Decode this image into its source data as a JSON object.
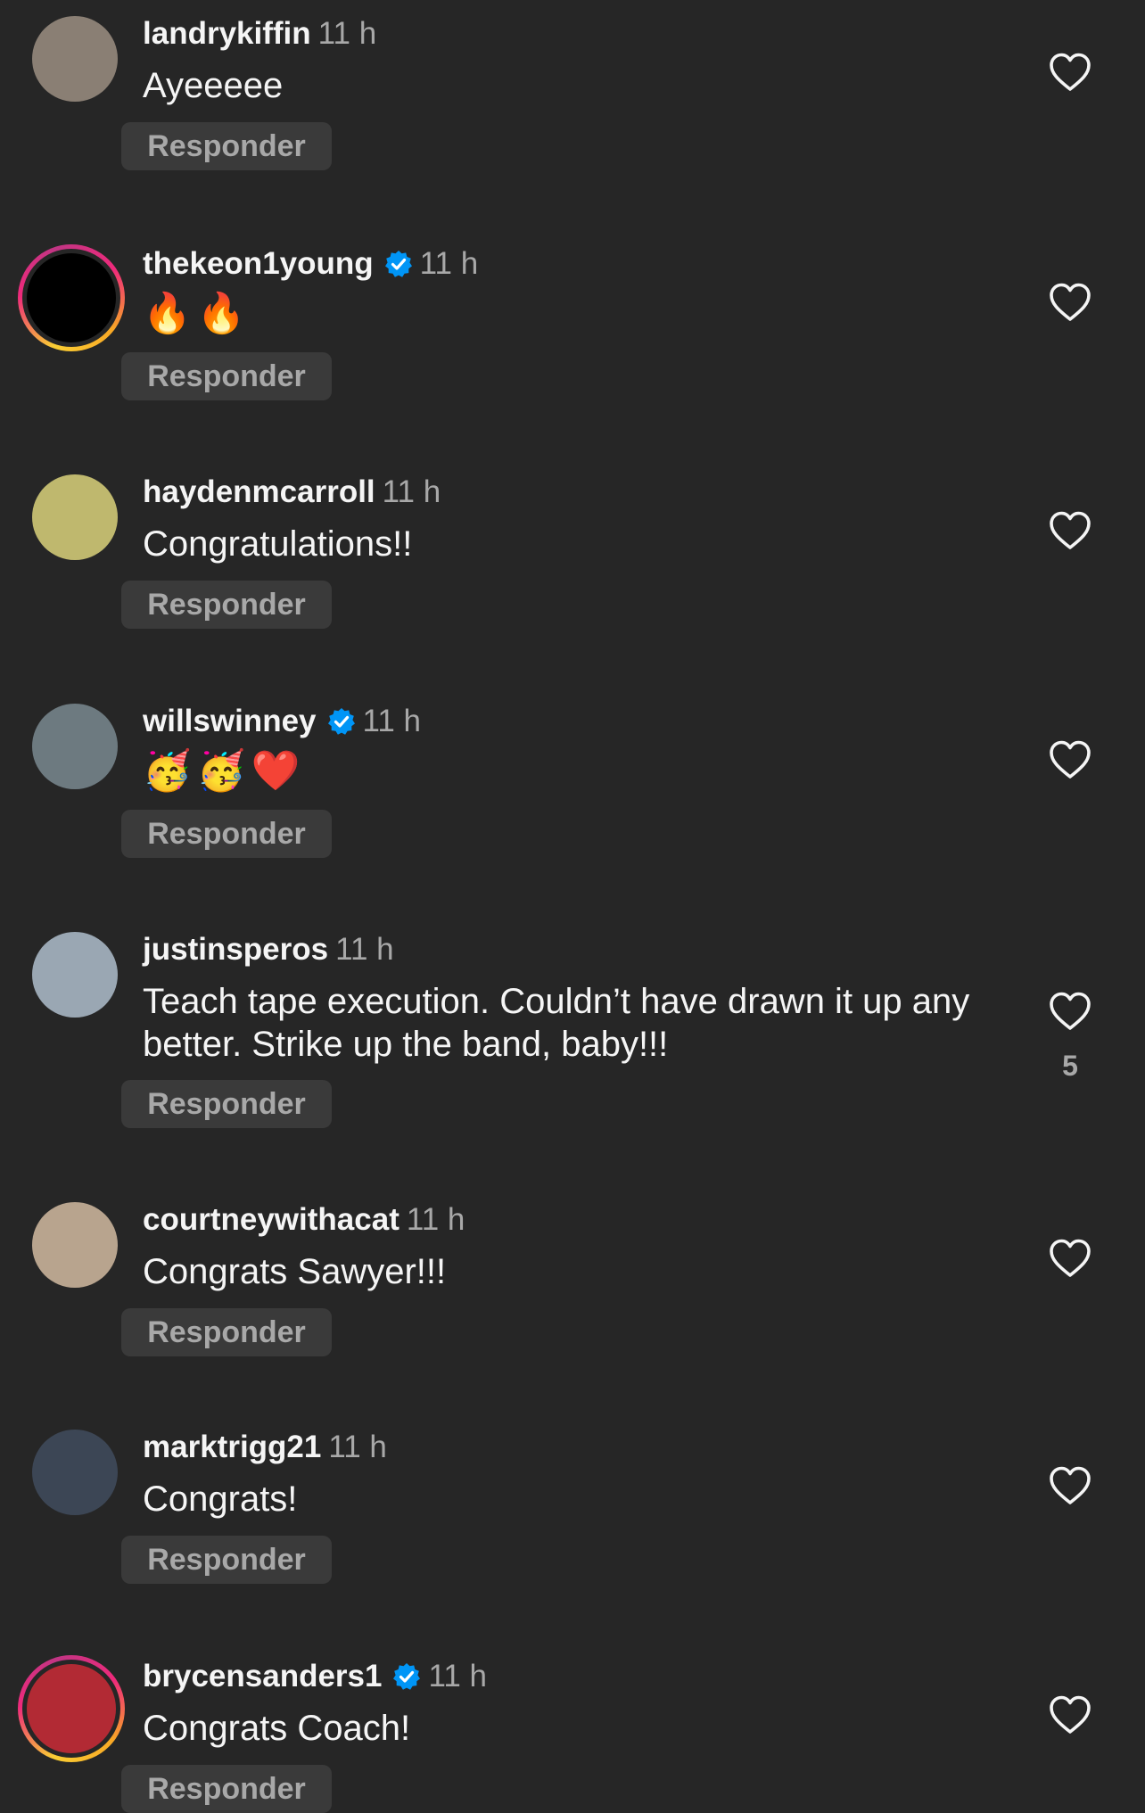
{
  "reply_label": "Responder",
  "comments": [
    {
      "username": "landrykiffin",
      "verified": false,
      "time": "11 h",
      "text": "Ayeeeee",
      "likes": "",
      "avatar_ring": false,
      "avatar_color": "#8a7f74"
    },
    {
      "username": "thekeon1young",
      "verified": true,
      "time": "11 h",
      "text": "🔥🔥",
      "likes": "",
      "avatar_ring": true,
      "avatar_color": "#000000"
    },
    {
      "username": "haydenmcarroll",
      "verified": false,
      "time": "11 h",
      "text": "Congratulations!!",
      "likes": "",
      "avatar_ring": false,
      "avatar_color": "#bfb86e"
    },
    {
      "username": "willswinney",
      "verified": true,
      "time": "11 h",
      "text": "🥳🥳❤️",
      "likes": "",
      "avatar_ring": false,
      "avatar_color": "#6d7a80"
    },
    {
      "username": "justinsperos",
      "verified": false,
      "time": "11 h",
      "text": "Teach tape execution. Couldn’t have drawn it up any better. Strike up the band, baby!!!",
      "likes": "5",
      "avatar_ring": false,
      "avatar_color": "#9aa7b3"
    },
    {
      "username": "courtneywithacat",
      "verified": false,
      "time": "11 h",
      "text": "Congrats Sawyer!!!",
      "likes": "",
      "avatar_ring": false,
      "avatar_color": "#b8a48e"
    },
    {
      "username": "marktrigg21",
      "verified": false,
      "time": "11 h",
      "text": "Congrats!",
      "likes": "",
      "avatar_ring": false,
      "avatar_color": "#3c4655"
    },
    {
      "username": "brycensanders1",
      "verified": true,
      "time": "11 h",
      "text": "Congrats Coach!",
      "likes": "",
      "avatar_ring": true,
      "avatar_color": "#b22a34"
    }
  ],
  "colors": {
    "background": "#262626",
    "reply_bg": "#3a3a3a",
    "secondary_text": "#a8a8a8",
    "verified_blue": "#0095f6"
  }
}
